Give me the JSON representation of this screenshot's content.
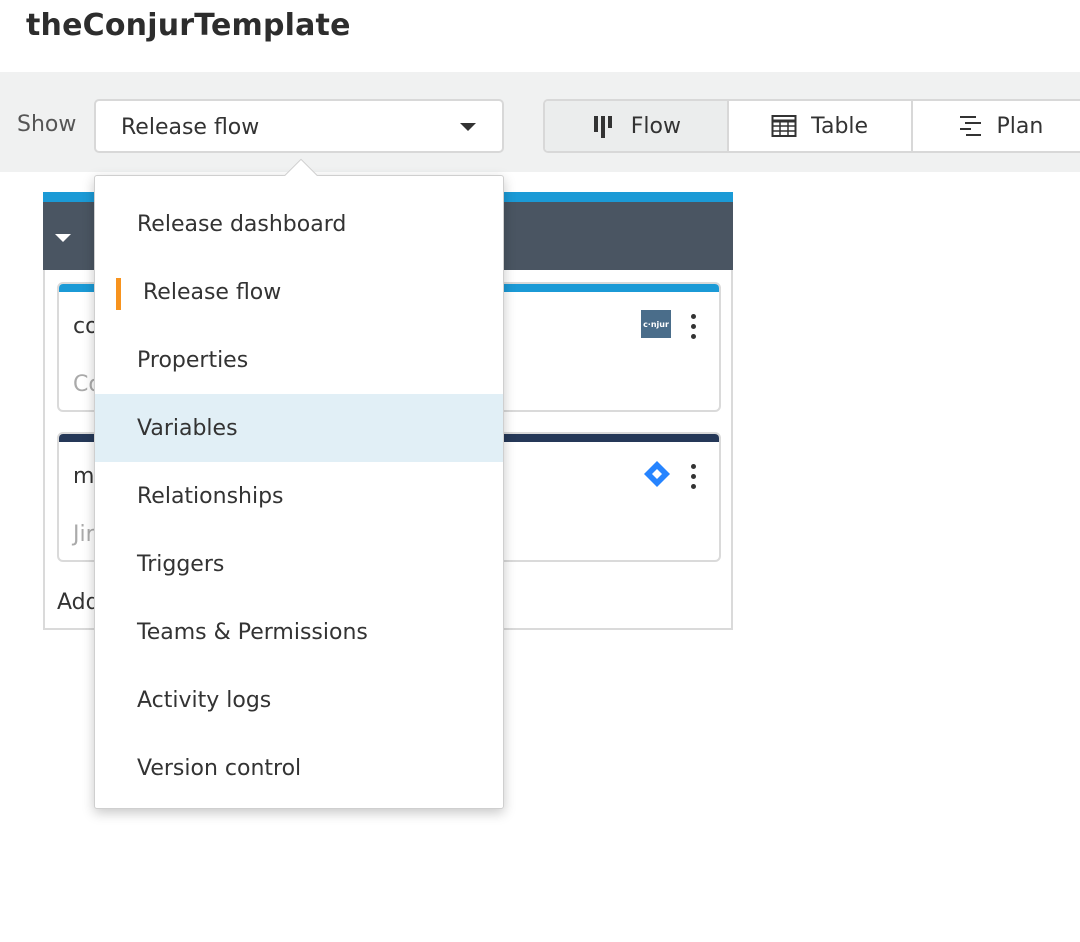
{
  "page": {
    "title": "theConjurTemplate"
  },
  "toolbar": {
    "show_label": "Show",
    "select_value": "Release flow",
    "views": [
      {
        "label": "Flow",
        "icon": "flow-icon",
        "active": true
      },
      {
        "label": "Table",
        "icon": "table-icon",
        "active": false
      },
      {
        "label": "Plan",
        "icon": "planner-icon",
        "active": false
      }
    ]
  },
  "phase": {
    "tasks": [
      {
        "title": "co",
        "subtitle": "Co",
        "accent": "#1b9ad6",
        "icon": "conjur-logo",
        "icon_text": "c·njur"
      },
      {
        "title": "m",
        "subtitle": "Jir",
        "accent": "#253858",
        "icon": "jira-logo"
      }
    ],
    "add_text": "Add"
  },
  "dropdown": {
    "items": [
      {
        "label": "Release dashboard"
      },
      {
        "label": "Release flow",
        "selected": true
      },
      {
        "label": "Properties"
      },
      {
        "label": "Variables",
        "hover": true
      },
      {
        "label": "Relationships"
      },
      {
        "label": "Triggers"
      },
      {
        "label": "Teams & Permissions"
      },
      {
        "label": "Activity logs"
      },
      {
        "label": "Version control"
      }
    ]
  },
  "colors": {
    "accent_marker": "#f7931e",
    "hover_bg": "#e1eff6",
    "phase_header": "#4a5562",
    "phase_top": "#1b9ad6"
  }
}
